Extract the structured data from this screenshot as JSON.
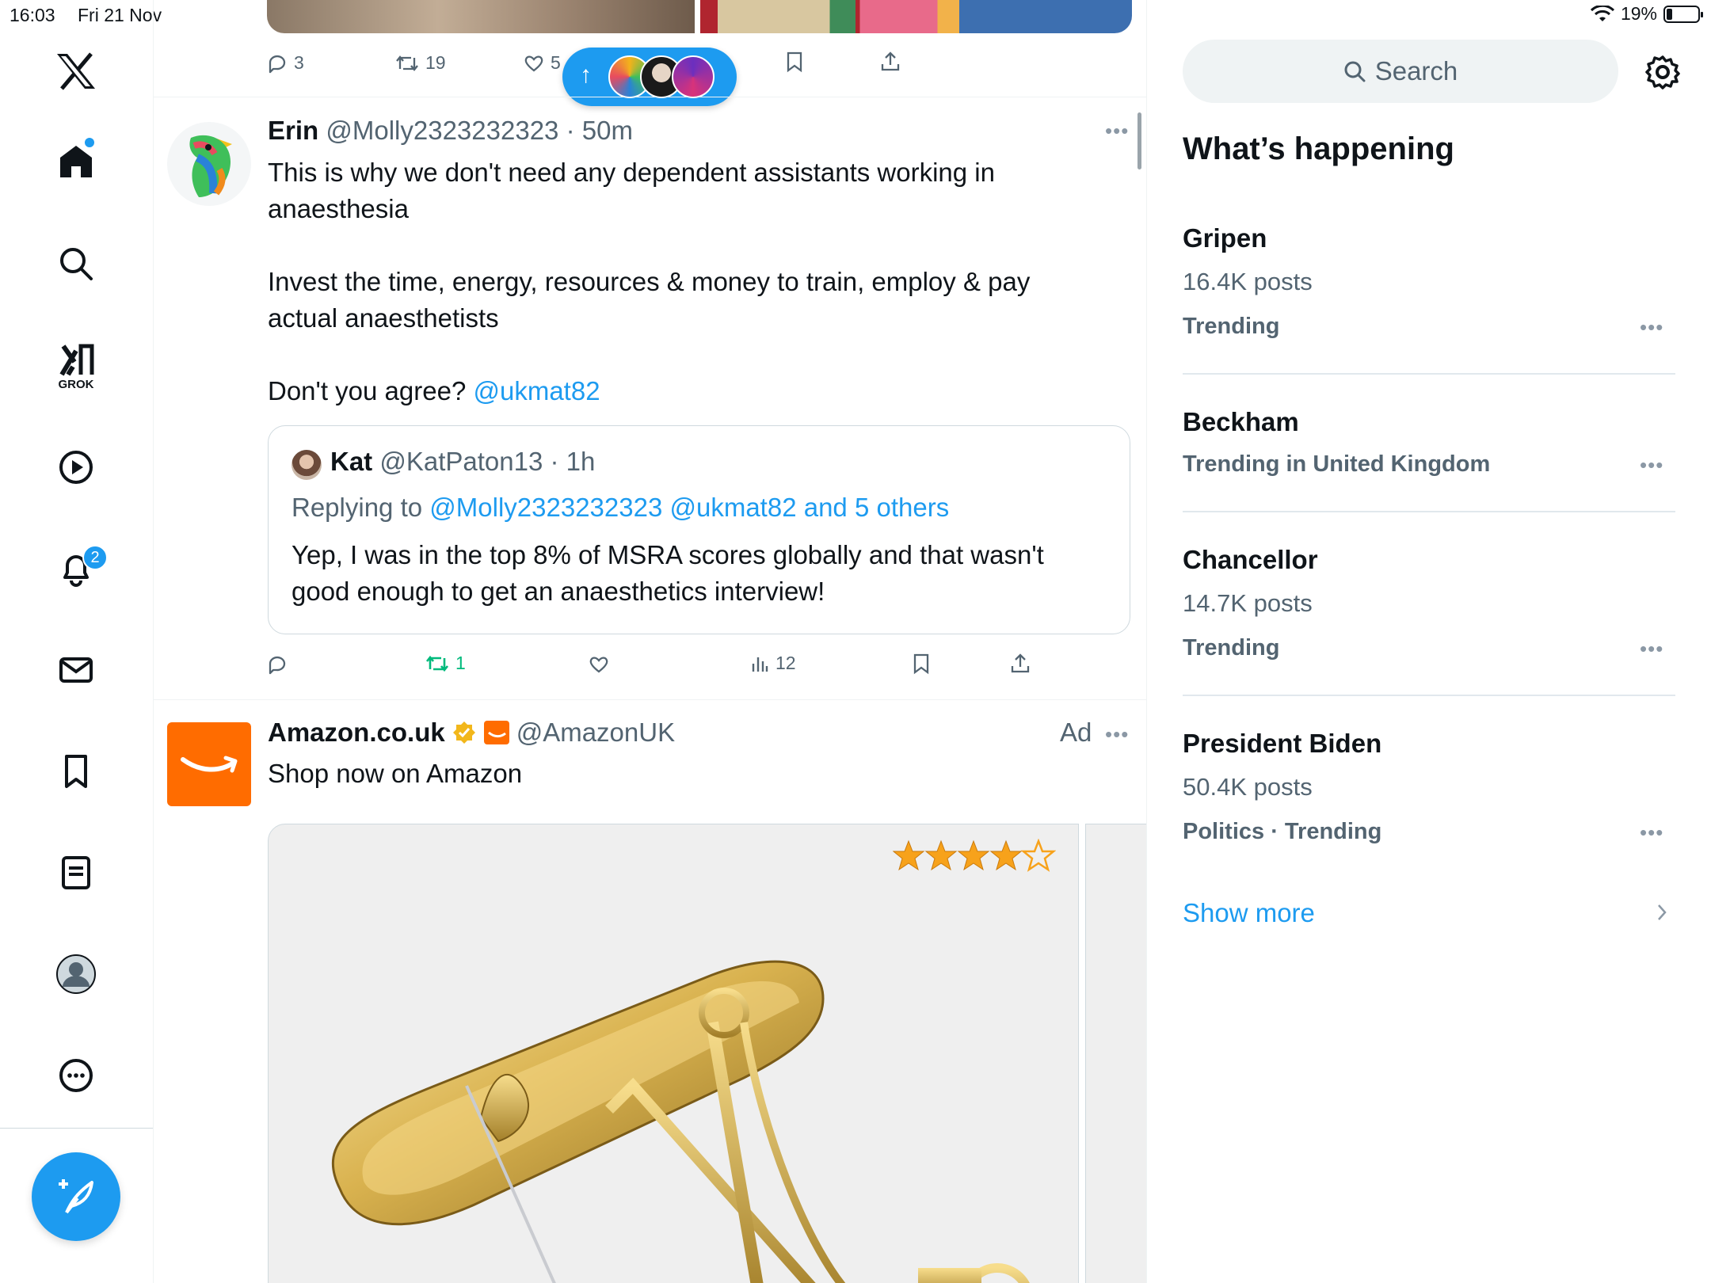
{
  "status_bar": {
    "time": "16:03",
    "date": "Fri 21 Nov",
    "battery": "19%"
  },
  "nav": {
    "grok_label": "GROK",
    "notifications_badge": "2",
    "items": [
      "x-logo",
      "home",
      "search",
      "grok",
      "video",
      "notifications",
      "messages",
      "bookmarks",
      "lists",
      "profile",
      "more"
    ]
  },
  "top_tweet_actions": {
    "replies": "3",
    "retweets": "19",
    "likes": "5"
  },
  "floating_pill": {
    "arrow": "↑"
  },
  "tweet": {
    "name": "Erin",
    "handle": "@Molly2323232323",
    "time": "50m",
    "line1": "This is why we don't need any dependent assistants working in",
    "line2": "anaesthesia",
    "line3": "Invest the time, energy, resources & money to train, employ & pay",
    "line4": "actual anaesthetists",
    "line5_prefix": "Don't you agree?",
    "mention": "@ukmat82",
    "quote": {
      "name": "Kat",
      "handle": "@KatPaton13",
      "time": "1h",
      "replying_prefix": "Replying to",
      "replying_to": "@Molly2323232323 @ukmat82 and 5 others",
      "line1": "Yep, I was in the top 8% of MSRA scores globally and that wasn't",
      "line2": "good enough to get an anaesthetics interview!"
    },
    "actions": {
      "retweets": "1",
      "views": "12"
    }
  },
  "ad": {
    "name": "Amazon.co.uk",
    "handle": "@AmazonUK",
    "ad_label": "Ad",
    "text": "Shop now on Amazon",
    "rating_stars": 4.5
  },
  "sidebar": {
    "search_placeholder": "Search",
    "heading": "What’s happening",
    "trends": [
      {
        "title": "Gripen",
        "posts": "16.4K posts",
        "meta": "Trending"
      },
      {
        "title": "Beckham",
        "posts": "",
        "meta": "Trending in United Kingdom"
      },
      {
        "title": "Chancellor",
        "posts": "14.7K posts",
        "meta": "Trending"
      },
      {
        "title": "President Biden",
        "posts": "50.4K posts",
        "meta": "Politics · Trending"
      }
    ],
    "show_more": "Show more"
  },
  "colors": {
    "accent": "#1d9bf0",
    "retweet_green": "#00ba7c",
    "amazon_orange": "#ff6c00",
    "star_gold": "#f7a21b"
  }
}
